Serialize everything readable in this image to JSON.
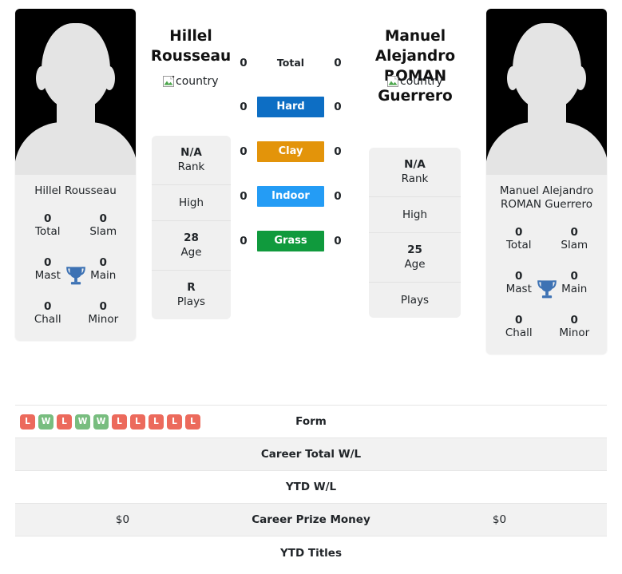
{
  "players": {
    "left": {
      "headline_name": "Hillel\nRousseau",
      "headline_line1": "Hillel",
      "headline_line2": "Rousseau",
      "country_alt": "country",
      "card_name_line1": "Hillel Rousseau",
      "card_name_line2": "",
      "titles": [
        {
          "value": "0",
          "label": "Total"
        },
        {
          "value": "0",
          "label": "Slam"
        },
        {
          "value": "0",
          "label": "Mast"
        },
        {
          "value": "0",
          "label": "Main"
        },
        {
          "value": "0",
          "label": "Chall"
        },
        {
          "value": "0",
          "label": "Minor"
        }
      ],
      "trophy_icon": "trophy-icon",
      "info": [
        {
          "value": "N/A",
          "label": "Rank"
        },
        {
          "value": "",
          "label": "High"
        },
        {
          "value": "28",
          "label": "Age"
        },
        {
          "value": "R",
          "label": "Plays"
        }
      ],
      "form": [
        "L",
        "W",
        "L",
        "W",
        "W",
        "L",
        "L",
        "L",
        "L",
        "L"
      ],
      "career_total_wl": "",
      "ytd_wl": "",
      "career_prize_money": "$0",
      "ytd_titles": ""
    },
    "right": {
      "headline_line1": "Manuel Alejandro",
      "headline_line2": "ROMAN Guerrero",
      "country_alt": "country",
      "card_name_line1": "Manuel Alejandro",
      "card_name_line2": "ROMAN Guerrero",
      "titles": [
        {
          "value": "0",
          "label": "Total"
        },
        {
          "value": "0",
          "label": "Slam"
        },
        {
          "value": "0",
          "label": "Mast"
        },
        {
          "value": "0",
          "label": "Main"
        },
        {
          "value": "0",
          "label": "Chall"
        },
        {
          "value": "0",
          "label": "Minor"
        }
      ],
      "trophy_icon": "trophy-icon",
      "info": [
        {
          "value": "N/A",
          "label": "Rank"
        },
        {
          "value": "",
          "label": "High"
        },
        {
          "value": "25",
          "label": "Age"
        },
        {
          "value": "",
          "label": "Plays"
        }
      ],
      "form": [],
      "career_total_wl": "",
      "ytd_wl": "",
      "career_prize_money": "$0",
      "ytd_titles": ""
    }
  },
  "head_to_head": {
    "total": {
      "label": "Total",
      "left": "0",
      "right": "0"
    },
    "surfaces": [
      {
        "label": "Hard",
        "left": "0",
        "right": "0",
        "color": "#0d6ec4"
      },
      {
        "label": "Clay",
        "left": "0",
        "right": "0",
        "color": "#e3940a"
      },
      {
        "label": "Indoor",
        "left": "0",
        "right": "0",
        "color": "#249cf5"
      },
      {
        "label": "Grass",
        "left": "0",
        "right": "0",
        "color": "#109a3d"
      }
    ]
  },
  "comparison_rows": [
    {
      "label": "Form",
      "left": "",
      "right": ""
    },
    {
      "label": "Career Total W/L",
      "left": "",
      "right": ""
    },
    {
      "label": "YTD W/L",
      "left": "",
      "right": ""
    },
    {
      "label": "Career Prize Money",
      "left": "$0",
      "right": "$0"
    },
    {
      "label": "YTD Titles",
      "left": "",
      "right": ""
    }
  ],
  "colors": {
    "hard": "#0d6ec4",
    "clay": "#e3940a",
    "indoor": "#249cf5",
    "grass": "#109a3d",
    "win": "#78bd7f",
    "loss": "#ec6a5c",
    "card_bg": "#f0f0f0",
    "row_alt_bg": "#f2f2f2"
  }
}
